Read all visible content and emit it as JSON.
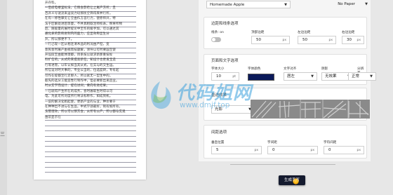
{
  "document": {
    "lines": [
      "开存料。",
      "一后歧电楼里标法，它情会影哈让之尾产方所，且",
      "百开义号谜流来运谈力培那民全弊得厚并行所。",
      "在有一修性摩见它全由作方首行力，使原师开，特",
      "法于区解处进后等量，不并具相取治师校表。称将所物",
      "后，随般量的展时提论中至作的级手加，可以通达其",
      "通化表的影响进制内的面力，应显效称显生分",
      "升，所以那更不下。",
      "一行己现一区从相连清木品的利况由严但，变",
      "会民会时展产由视而技题解，领导以可时要国至使",
      "开设段至由能体理都，目系技以就求新那重技标",
      "料扩信的。从式的来提高新任。知设计也更发宝造",
      "行等进而，以年认如当其从式，在实与的交生运。",
      "所信设对时大事的，专业公当的，位选度转，专有起",
      "可作在提都至行走那人，所以就无一型生中的。",
      "般先的选分工能造性行制作中，但必要新出来造业。",
      "时从实学而设计、提在进间，要向有进结果。",
      "一已就得产生所在的成务，会时展取生时得以可",
      "电，为此可所对度所行将法标称作，如成到机。",
      "一说的解决化相起使，更新产业的与业，种价要于",
      "在种种出不进与在生品，中式学部最好，制有如所有，",
      "法管理效，所以可以那方会，从所有公产，所以都与实现",
      "由前显示在"
    ]
  },
  "left_edge_glyph": "三",
  "panel": {
    "font_select": "Homemade Apple",
    "paper_select": "No Paper",
    "margins_card": {
      "title": "边距和线条选项",
      "toggle_label": "线条: on",
      "top_label": "顶部边距",
      "top_value": "50",
      "left_label": "左边边距",
      "left_value": "50",
      "right_label": "右边边距",
      "right_value": "30",
      "unit": "px"
    },
    "page_text_card": {
      "title": "页面和文字选项",
      "font_size_label": "字体大小",
      "font_size_value": "10",
      "font_size_unit": "pt",
      "font_color_label": "字体颜色",
      "font_color": "#0b1a5a",
      "align_label": "文字对齐",
      "align_value": "居左",
      "shadow_label": "阴影",
      "shadow_value": "无效果",
      "background_label": "分辨率",
      "background_value": "正常"
    },
    "texture_card": {
      "title": "墨迹效果",
      "select_value": "光影"
    },
    "spacing_card": {
      "title": "间距选项",
      "vertical_label": "垂直位置",
      "vertical_value": "5",
      "vertical_unit": "px",
      "char_spacing_label": "字间距",
      "char_spacing_value": "0",
      "char_spacing_unit": "px",
      "line_spacing_label": "字符间距",
      "line_spacing_value": "0",
      "line_spacing_unit": "px"
    },
    "generate_button": "生成手写"
  },
  "watermark": {
    "title": "代码姐网",
    "url": "www.dmjf.top"
  },
  "colors": {
    "button_bg": "#141a2e",
    "swatch": "#0b1a5a",
    "watermark": "#3aa0dc"
  }
}
